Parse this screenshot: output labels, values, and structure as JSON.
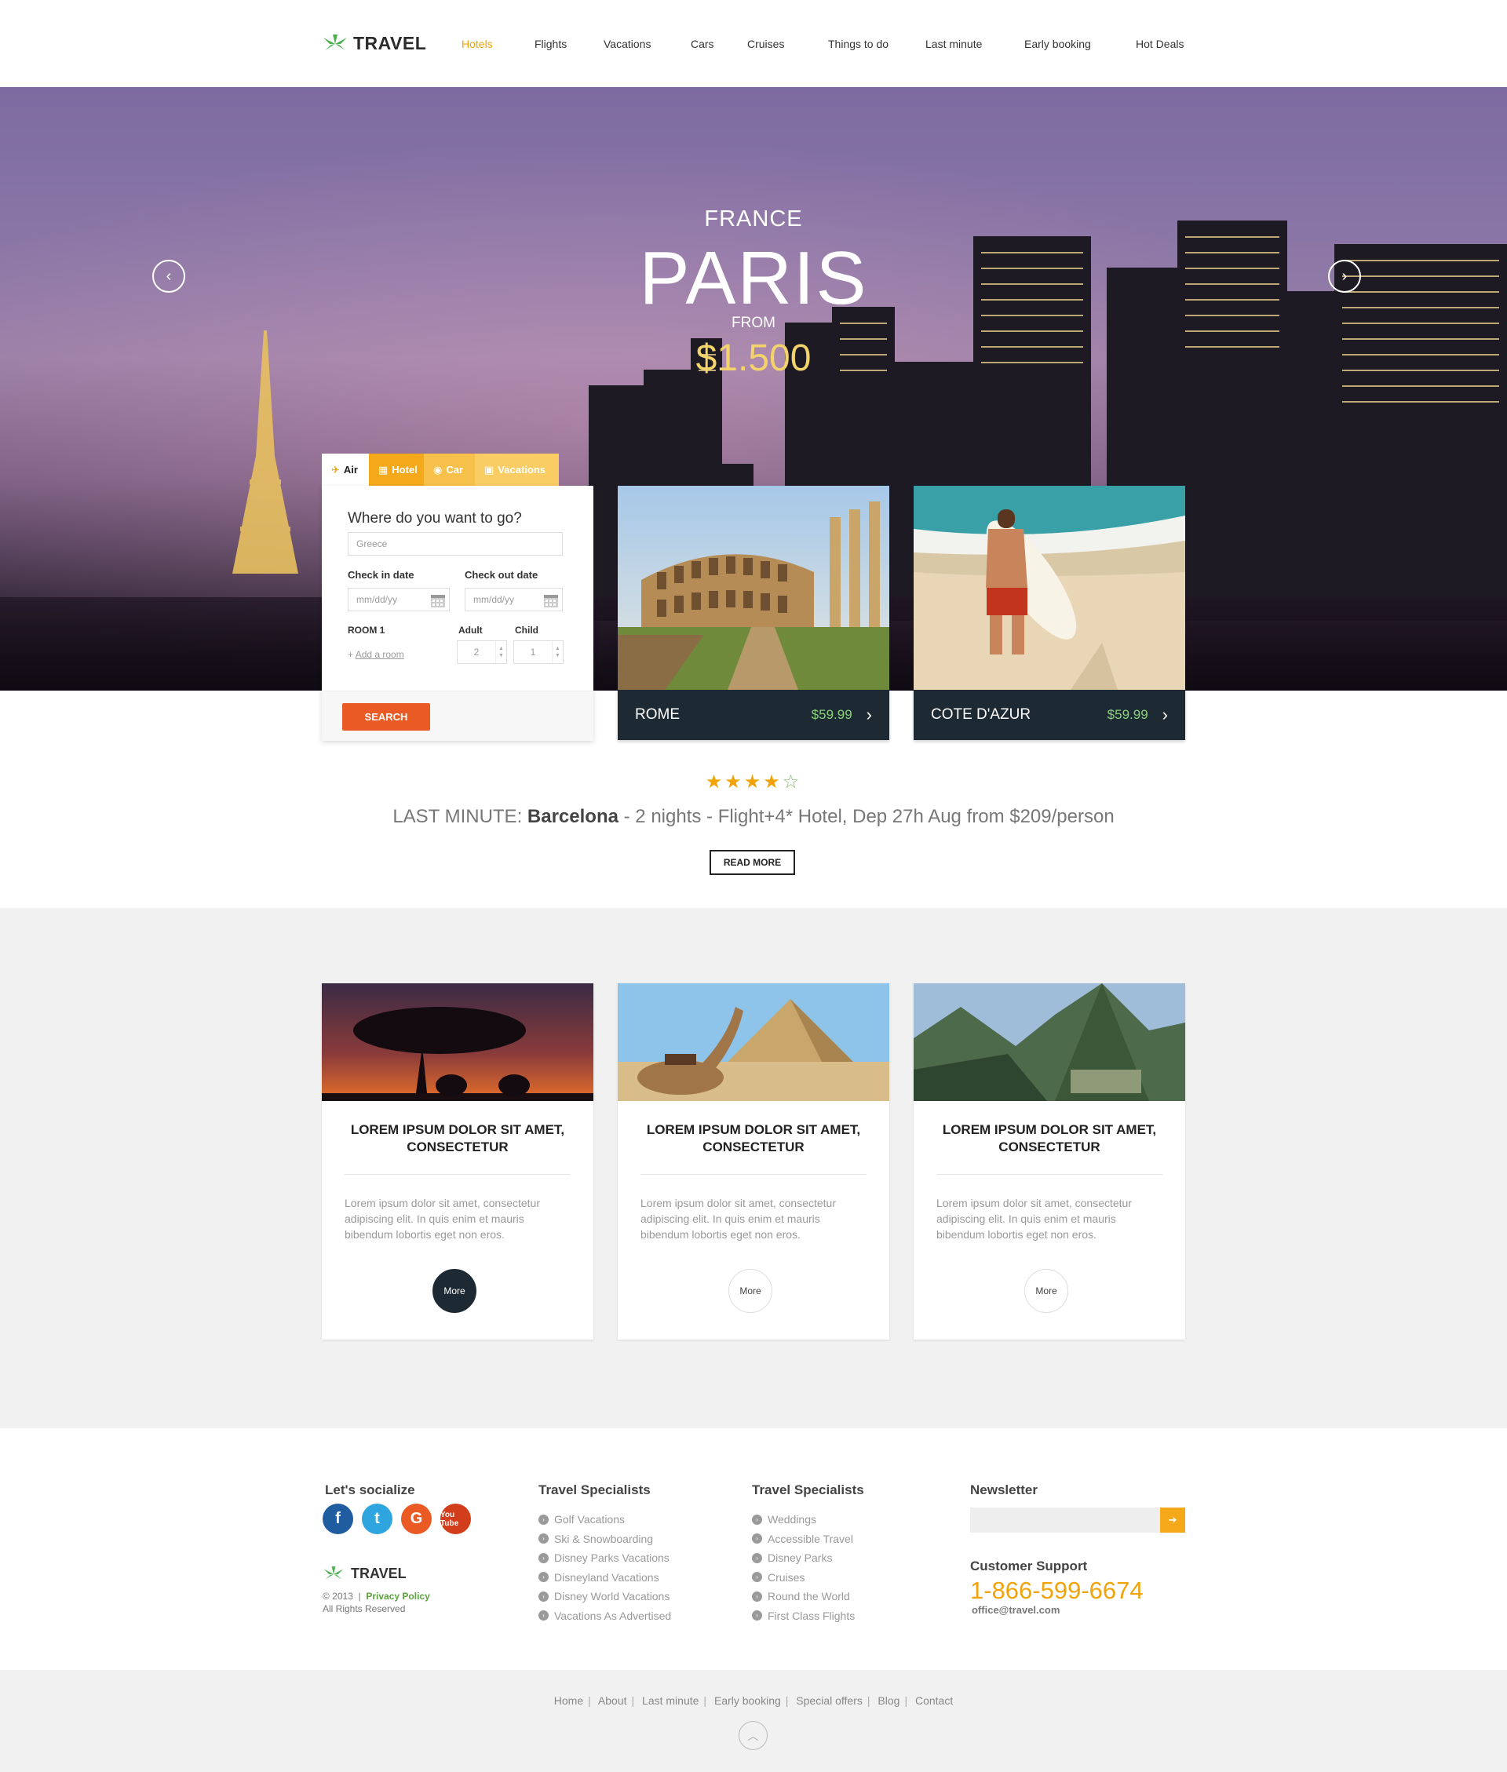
{
  "header": {
    "logo_text": "TRAVEL",
    "nav": [
      {
        "label": "Hotels",
        "active": true
      },
      {
        "label": "Flights"
      },
      {
        "label": "Vacations"
      },
      {
        "label": "Cars"
      },
      {
        "label": "Cruises"
      },
      {
        "label": "Things to do"
      },
      {
        "label": "Last minute"
      },
      {
        "label": "Early booking"
      },
      {
        "label": "Hot Deals"
      }
    ]
  },
  "hero": {
    "country": "FRANCE",
    "city": "PARIS",
    "from_label": "FROM",
    "price": "$1.500"
  },
  "search": {
    "tabs": [
      {
        "label": "Air",
        "icon": "plane-icon"
      },
      {
        "label": "Hotel",
        "icon": "hotel-icon"
      },
      {
        "label": "Car",
        "icon": "car-icon"
      },
      {
        "label": "Vacations",
        "icon": "suitcase-icon"
      }
    ],
    "title": "Where do you want to go?",
    "destination_placeholder": "Greece",
    "checkin_label": "Check in date",
    "checkout_label": "Check out date",
    "date_placeholder": "mm/dd/yy",
    "room_label": "ROOM 1",
    "adult_label": "Adult",
    "child_label": "Child",
    "adult_value": "2",
    "child_value": "1",
    "add_room_prefix": "+",
    "add_room_label": "Add a room",
    "search_button": "SEARCH"
  },
  "destinations": [
    {
      "name": "ROME",
      "price": "$59.99"
    },
    {
      "name": "COTE D'AZUR",
      "price": "$59.99"
    }
  ],
  "last_minute": {
    "rating": 4,
    "max_rating": 5,
    "prefix": "LAST MINUTE:",
    "city": "Barcelona",
    "details": "- 2 nights - Flight+4* Hotel, Dep 27h Aug from $209/person",
    "button": "READ MORE"
  },
  "features": [
    {
      "title": "LOREM IPSUM DOLOR SIT AMET, CONSECTETUR",
      "text": "Lorem ipsum dolor sit amet, consectetur adipiscing elit. In quis enim et mauris bibendum lobortis eget non eros.",
      "button": "More"
    },
    {
      "title": "LOREM IPSUM DOLOR SIT AMET, CONSECTETUR",
      "text": "Lorem ipsum dolor sit amet, consectetur adipiscing elit. In quis enim et mauris bibendum lobortis eget non eros.",
      "button": "More"
    },
    {
      "title": "LOREM IPSUM DOLOR SIT AMET, CONSECTETUR",
      "text": "Lorem ipsum dolor sit amet, consectetur adipiscing elit. In quis enim et mauris bibendum lobortis eget non eros.",
      "button": "More"
    }
  ],
  "footer": {
    "social_heading": "Let's socialize",
    "social": [
      {
        "icon": "facebook-icon",
        "glyph": "f"
      },
      {
        "icon": "twitter-icon",
        "glyph": "t"
      },
      {
        "icon": "google-plus-icon",
        "glyph": "G"
      },
      {
        "icon": "youtube-icon",
        "glyph": "You Tube"
      }
    ],
    "logo_text": "TRAVEL",
    "copyright": "© 2013",
    "privacy": "Privacy Policy",
    "rights": "All Rights Reserved",
    "col1_heading": "Travel Specialists",
    "col1_links": [
      "Golf Vacations",
      "Ski & Snowboarding",
      "Disney Parks Vacations",
      "Disneyland Vacations",
      "Disney World Vacations",
      "Vacations As Advertised"
    ],
    "col2_heading": "Travel Specialists",
    "col2_links": [
      "Weddings",
      "Accessible Travel",
      "Disney Parks",
      "Cruises",
      "Round the World",
      "First Class Flights"
    ],
    "newsletter_heading": "Newsletter",
    "support_heading": "Customer Support",
    "phone": "1-866-599-6674",
    "email": "office@travel.com"
  },
  "bottom_links": [
    "Home",
    "About",
    "Last minute",
    "Early booking",
    "Special offers",
    "Blog",
    "Contact"
  ],
  "colors": {
    "accent_orange": "#f0a30a",
    "search_red": "#ea5a24",
    "dark_navy": "#1e2a33",
    "price_green": "#8ad07a"
  }
}
